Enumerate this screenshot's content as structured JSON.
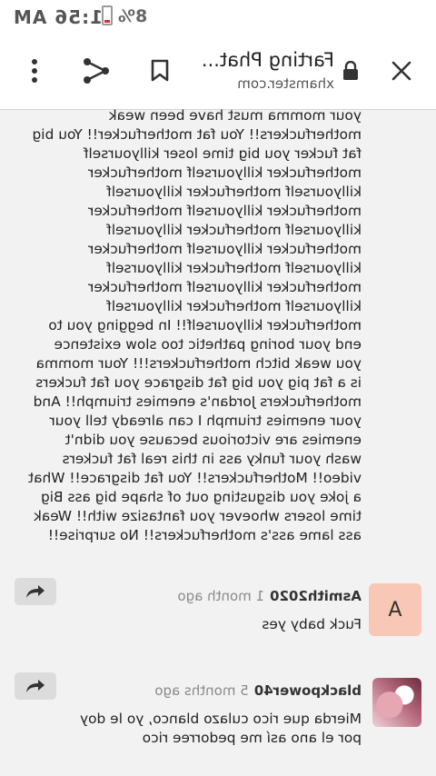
{
  "status_bar": {
    "time": "1:56 AM",
    "battery": "8%"
  },
  "toolbar": {
    "title": "Farting Phat...",
    "domain": "xhamster.com"
  },
  "body_text": "your momma must have been weak\nmotherfuckers!! You fat motherfucker!! You big\nfat fucker you big time loser killyourself\nmotherfucker killyourself motherfucker\nkillyourself motherfucker killyourself\nmotherfucker killyourself motherfucker\nkillyourself motherfucker killyourself\nmotherfucker killyourself motherfucker\nkillyourself motherfucker killyourself\nmotherfucker killyourself motherfucker\nkillyourself motherfucker killyourself\nmotherfucker killyourself!! In begging you to\nend your boring pathetic too slow existence\nyou weak bitch motherfuckers!!! Your momma\nis a fat pig you big fat disgrace you fat fuckers\nmotherfuckers Jordan's enemies triumph!! And\nyour enemies triumph I can already tell your\nenemies are victorious because you didn't\nwash your funky ass in this real fat fuckers\nvideo!! Motherfuckers!! You fat disgrace!! What\na joke you disgusting out of shape big ass Big\ntime losers whoever you fantasize with!! Weak\nass lame ass's motherfuckers!! No surprise!!",
  "comments": [
    {
      "avatar_letter": "A",
      "avatar_color": "#f8c7b5",
      "user": "Asmith2020",
      "time": "1 month ago",
      "text": "Fuck baby yes"
    },
    {
      "avatar_letter": "",
      "user": "blackpower40",
      "time": "5 months ago",
      "text": "Mierda que rico culazo blanco, yo le doy por el ano así me pedorree rico"
    }
  ],
  "icons": {
    "close": "close-icon",
    "lock": "lock-icon",
    "bookmark": "bookmark-icon",
    "share": "share-icon",
    "menu": "more-vert-icon",
    "reply": "reply-icon"
  }
}
